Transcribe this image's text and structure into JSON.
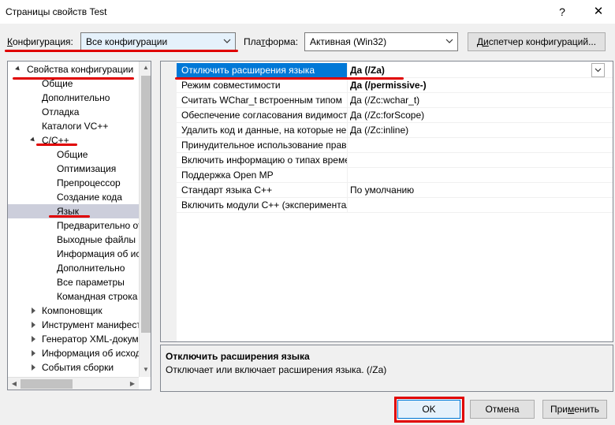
{
  "window": {
    "title": "Страницы свойств Test",
    "help_glyph": "?",
    "close_glyph": "✕"
  },
  "toolbar": {
    "config_label_ul": "К",
    "config_label_rest": "онфигурация:",
    "config_value": "Все конфигурации",
    "platform_label_a": "Пла",
    "platform_label_ul": "т",
    "platform_label_b": "форма:",
    "platform_value": "Активная (Win32)",
    "manager_label_a": "Д",
    "manager_label_ul": "и",
    "manager_label_b": "спетчер конфигураций..."
  },
  "tree": {
    "items": [
      {
        "label": "Свойства конфигурации",
        "expander": "open"
      },
      {
        "label": "Общие",
        "expander": "none"
      },
      {
        "label": "Дополнительно",
        "expander": "none"
      },
      {
        "label": "Отладка",
        "expander": "none"
      },
      {
        "label": "Каталоги VC++",
        "expander": "none"
      },
      {
        "label": "C/C++",
        "expander": "open"
      },
      {
        "label": "Общие",
        "expander": "none"
      },
      {
        "label": "Оптимизация",
        "expander": "none"
      },
      {
        "label": "Препроцессор",
        "expander": "none"
      },
      {
        "label": "Создание кода",
        "expander": "none"
      },
      {
        "label": "Язык",
        "expander": "none",
        "selected": true
      },
      {
        "label": "Предварительно откомпилированные заголовки",
        "expander": "none"
      },
      {
        "label": "Выходные файлы",
        "expander": "none"
      },
      {
        "label": "Информация об исходном коде",
        "expander": "none"
      },
      {
        "label": "Дополнительно",
        "expander": "none"
      },
      {
        "label": "Все параметры",
        "expander": "none"
      },
      {
        "label": "Командная строка",
        "expander": "none"
      },
      {
        "label": "Компоновщик",
        "expander": "closed"
      },
      {
        "label": "Инструмент манифеста",
        "expander": "closed"
      },
      {
        "label": "Генератор XML-документов",
        "expander": "closed"
      },
      {
        "label": "Информация об исходном коде",
        "expander": "closed"
      },
      {
        "label": "События сборки",
        "expander": "closed"
      }
    ]
  },
  "grid": {
    "rows": [
      {
        "name": "Отключить расширения языка",
        "value": "Да (/Za)",
        "bold": true,
        "selected": true
      },
      {
        "name": "Режим совместимости",
        "value": "Да (/permissive-)",
        "bold": true
      },
      {
        "name": "Считать WChar_t встроенным типом",
        "value": "Да (/Zc:wchar_t)",
        "bold": false
      },
      {
        "name": "Обеспечение согласования видимости",
        "value": "Да (/Zc:forScope)",
        "bold": false
      },
      {
        "name": "Удалить код и данные, на которые не ссылаются",
        "value": "Да (/Zc:inline)",
        "bold": false
      },
      {
        "name": "Принудительное использование правил",
        "value": "",
        "bold": false
      },
      {
        "name": "Включить информацию о типах времени выполнения",
        "value": "",
        "bold": false
      },
      {
        "name": "Поддержка Open MP",
        "value": "",
        "bold": false
      },
      {
        "name": "Стандарт языка C++",
        "value": "По умолчанию",
        "bold": false
      },
      {
        "name": "Включить модули C++ (экспериментальная функция)",
        "value": "",
        "bold": false
      }
    ]
  },
  "description": {
    "title": "Отключить расширения языка",
    "text": "Отключает или включает расширения языка.     (/Za)"
  },
  "buttons": {
    "ok_label": "OK",
    "cancel_label": "Отмена",
    "apply_label_a": "При",
    "apply_label_ul": "м",
    "apply_label_b": "енить"
  },
  "colors": {
    "selection": "#0078d7",
    "tree_selection": "#cccedb",
    "annotation_red": "#e00000"
  }
}
